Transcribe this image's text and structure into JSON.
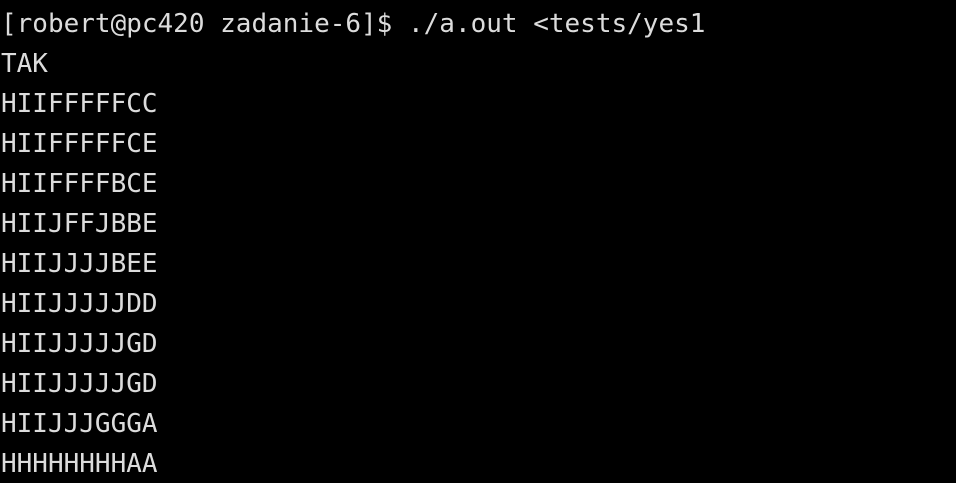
{
  "terminal": {
    "prompt": "[robert@pc420 zadanie-6]$ ./a.out <tests/yes1",
    "output": [
      "TAK",
      "HIIFFFFFCC",
      "HIIFFFFFCE",
      "HIIFFFFBCE",
      "HIIJFFJBBE",
      "HIIJJJJBEE",
      "HIIJJJJJDD",
      "HIIJJJJJGD",
      "HIIJJJJJGD",
      "HIIJJJGGGA",
      "HHHHHHHHAA"
    ],
    "colors": {
      "background": "#000000",
      "text": "#dcdcdc"
    }
  }
}
